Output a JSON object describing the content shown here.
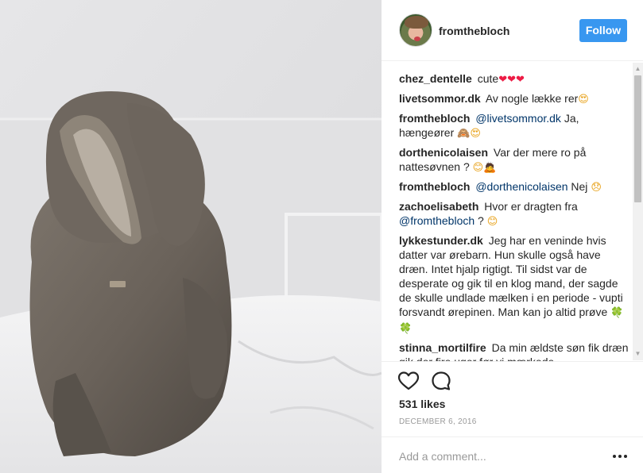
{
  "post": {
    "username": "fromthebloch",
    "follow_label": "Follow",
    "photo_alt": "Baby in grey knit bunny-ear hooded suit sitting on a white bed"
  },
  "comments": [
    {
      "user": "chez_dentelle",
      "text": "cute",
      "emoji": "❤❤❤"
    },
    {
      "user": "livetsommor.dk",
      "text": "Av nogle lække rer",
      "emoji": "😍"
    },
    {
      "user": "fromthebloch",
      "mention": "@livetsommor.dk",
      "text": "Ja, hængeører",
      "emoji": "🙈😍"
    },
    {
      "user": "dorthenicolaisen",
      "text": "Var der mere ro på nattesøvnen ?",
      "emoji": "😊🙇"
    },
    {
      "user": "fromthebloch",
      "mention": "@dorthenicolaisen",
      "text": "Nej",
      "emoji": "😞"
    },
    {
      "user": "zachoelisabeth",
      "text": "Hvor er dragten fra",
      "mention2": "@fromthebloch",
      "text2": "?",
      "emoji": "😊"
    },
    {
      "user": "lykkestunder.dk",
      "text": "Jeg har en veninde hvis datter var ørebarn. Hun skulle også have dræn. Intet hjalp rigtigt. Til sidst var de desperate og gik til en klog mand, der sagde de skulle undlade mælken i en periode - vupti forsvandt ørepinen. Man kan jo altid prøve",
      "emoji": "🍀🍀"
    },
    {
      "user": "stinna_mortilfire",
      "text": "Da min ældste søn fik dræn gik der fire uger før vi mærkede",
      "emoji": ""
    }
  ],
  "engagement": {
    "likes": "531 likes",
    "date": "DECEMBER 6, 2016",
    "comment_placeholder": "Add a comment..."
  },
  "icons": {
    "like": "heart-icon",
    "comment": "comment-bubble-icon",
    "more": "more-options-icon"
  },
  "colors": {
    "follow_button": "#3897f0",
    "text": "#262626",
    "mention": "#003569",
    "muted": "#999999"
  }
}
